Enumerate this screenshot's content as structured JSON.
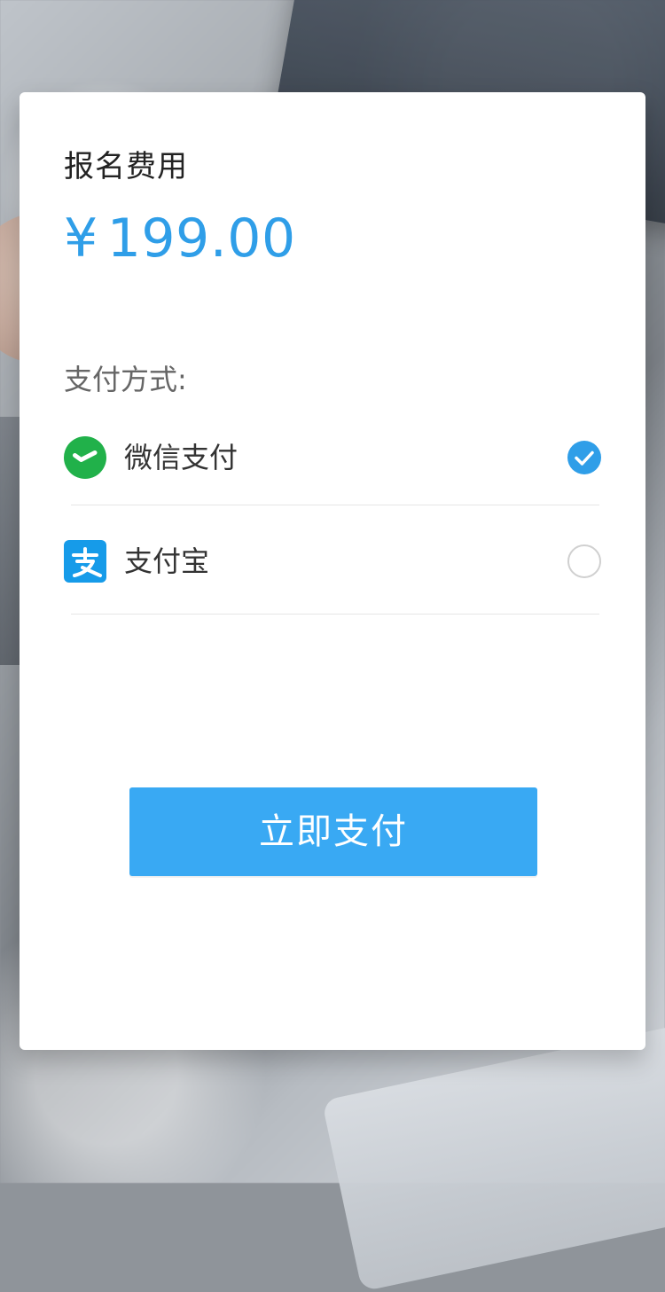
{
  "registration_fee": {
    "label": "报名费用",
    "currency_symbol": "¥",
    "amount": "199.00",
    "accent_color": "#2f9ee8"
  },
  "payment": {
    "method_label": "支付方式:",
    "options": [
      {
        "id": "wechat",
        "label": "微信支付",
        "icon": "wechat-pay-icon",
        "selected": true,
        "icon_color": "#21b14a"
      },
      {
        "id": "alipay",
        "label": "支付宝",
        "icon": "alipay-icon",
        "selected": false,
        "icon_color": "#169be9"
      }
    ]
  },
  "actions": {
    "pay_now_label": "立即支付",
    "button_color": "#39a9f3"
  }
}
